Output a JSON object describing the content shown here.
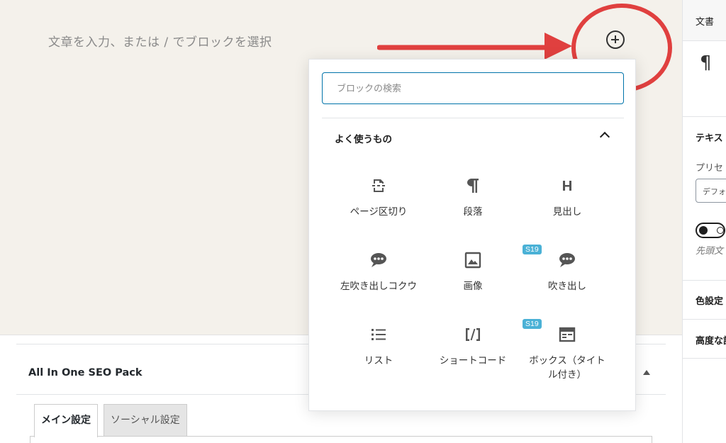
{
  "editor": {
    "placeholder": "文章を入力、または / でブロックを選択"
  },
  "inserter": {
    "search_placeholder": "ブロックの検索",
    "section_title": "よく使うもの",
    "blocks": [
      {
        "label": "ページ区切り",
        "icon": "page-break-icon"
      },
      {
        "label": "段落",
        "icon": "paragraph-icon"
      },
      {
        "label": "見出し",
        "icon": "heading-icon"
      },
      {
        "label": "左吹き出しコクウ",
        "icon": "speech-bubble-icon"
      },
      {
        "label": "画像",
        "icon": "image-icon"
      },
      {
        "label": "吹き出し",
        "icon": "speech-bubble-icon",
        "badge": "S19"
      },
      {
        "label": "リスト",
        "icon": "list-icon"
      },
      {
        "label": "ショートコード",
        "icon": "shortcode-icon"
      },
      {
        "label": "ボックス（タイトル付き）",
        "icon": "box-title-icon",
        "badge": "S19"
      }
    ]
  },
  "seo": {
    "title": "All In One SEO Pack",
    "tabs": [
      "メイン設定",
      "ソーシャル設定"
    ]
  },
  "sidebar": {
    "tab_label": "文書",
    "text_heading": "テキス",
    "preset_label": "プリセ",
    "select_value": "デフォ",
    "dropcap_label": "先頭文",
    "color_heading": "色設定",
    "advanced_heading": "高度な設"
  },
  "colors": {
    "annotation": "#e0403f",
    "search_focus": "#0073aa",
    "badge": "#4ab1d6"
  }
}
